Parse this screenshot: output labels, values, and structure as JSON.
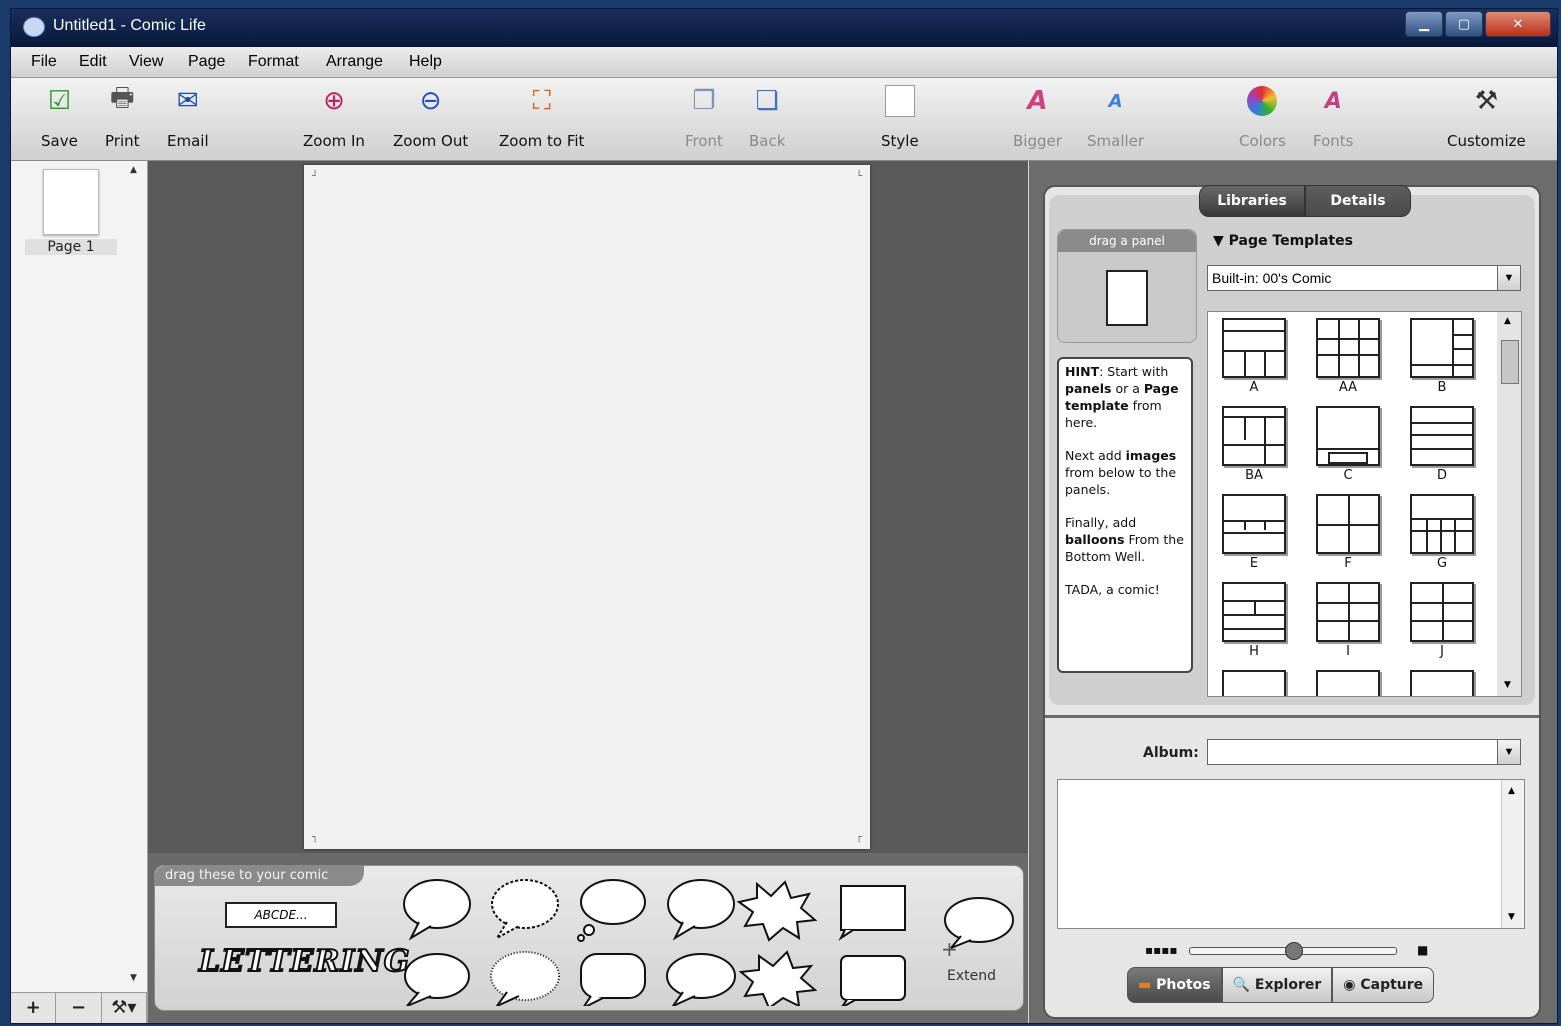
{
  "window": {
    "title": "Untitled1 - Comic Life"
  },
  "menu": [
    "File",
    "Edit",
    "View",
    "Page",
    "Format",
    "Arrange",
    "Help"
  ],
  "toolbar": {
    "save": "Save",
    "print": "Print",
    "email": "Email",
    "zoom_in": "Zoom In",
    "zoom_out": "Zoom Out",
    "zoom_fit": "Zoom to Fit",
    "front": "Front",
    "back": "Back",
    "style": "Style",
    "bigger": "Bigger",
    "smaller": "Smaller",
    "colors": "Colors",
    "fonts": "Fonts",
    "customize": "Customize"
  },
  "pages": {
    "items": [
      {
        "label": "Page 1"
      }
    ],
    "footer": [
      "+",
      "−",
      "⚒▾"
    ]
  },
  "well": {
    "tag": "drag these to your comic",
    "lettering_sample": "ABCDE...",
    "lettering_logo": "LETTERING",
    "extend": "Extend"
  },
  "library": {
    "tabs": {
      "libraries": "Libraries",
      "details": "Details"
    },
    "drag_panel": "drag a panel",
    "section_title": "Page Templates",
    "template_set": "Built-in: 00's Comic",
    "templates": [
      "A",
      "AA",
      "B",
      "BA",
      "C",
      "D",
      "E",
      "F",
      "G",
      "H",
      "I",
      "J"
    ],
    "hint": {
      "p1_a": "HINT",
      "p1_b": ": Start with ",
      "p1_c": "panels",
      "p1_d": " or a ",
      "p1_e": "Page template",
      "p1_f": " from here.",
      "p2_a": "Next add ",
      "p2_b": "images",
      "p2_c": " from below to the panels.",
      "p3_a": "Finally, add ",
      "p3_b": "balloons",
      "p3_c": " From the Bottom Well.",
      "p4": "TADA, a comic!"
    }
  },
  "browser": {
    "album_label": "Album:",
    "album_value": "",
    "tabs": {
      "photos": "Photos",
      "explorer": "Explorer",
      "capture": "Capture"
    },
    "zoom_level": 0.5
  },
  "colors": {
    "titlebar": "#07183a",
    "canvas": "#5a5a5a",
    "panel_bg": "#6c6c6c"
  }
}
